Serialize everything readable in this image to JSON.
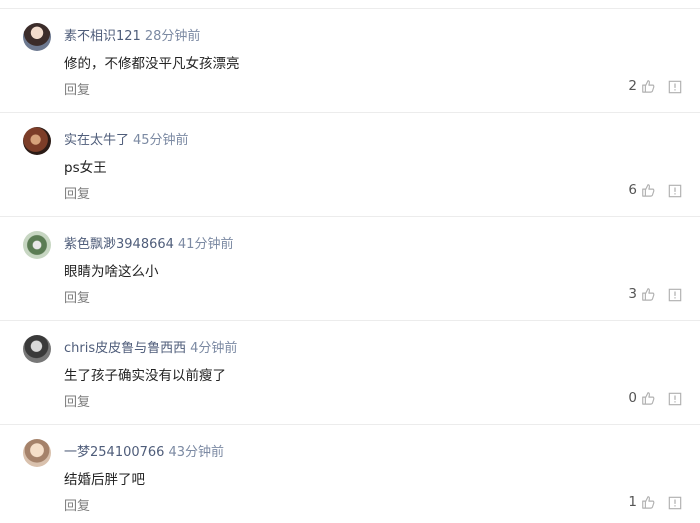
{
  "comments": [
    {
      "username": "素不相识121",
      "time": "28分钟前",
      "text": "修的，不修都没平凡女孩漂亮",
      "reply_label": "回复",
      "likes": "2"
    },
    {
      "username": "实在太牛了",
      "time": "45分钟前",
      "text": "ps女王",
      "reply_label": "回复",
      "likes": "6"
    },
    {
      "username": "紫色飘渺3948664",
      "time": "41分钟前",
      "text": "眼睛为啥这么小",
      "reply_label": "回复",
      "likes": "3"
    },
    {
      "username": "chris皮皮鲁与鲁西西",
      "time": "4分钟前",
      "text": "生了孩子确实没有以前瘦了",
      "reply_label": "回复",
      "likes": "0"
    },
    {
      "username": "一梦254100766",
      "time": "43分钟前",
      "text": "结婚后胖了吧",
      "reply_label": "回复",
      "likes": "1"
    }
  ],
  "icons": {
    "like": "thumbs-up-icon",
    "report": "report-icon"
  },
  "colors": {
    "username": "#4f5d7a",
    "reply": "#7d7d7d",
    "divider": "#ececec",
    "icon": "#b0b0b0"
  }
}
